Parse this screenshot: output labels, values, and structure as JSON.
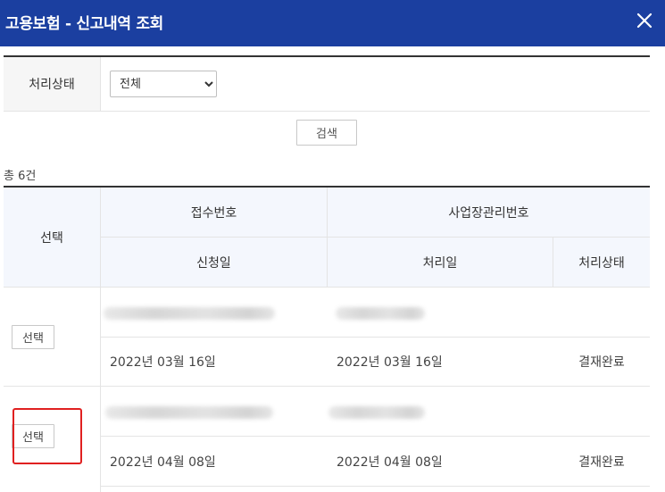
{
  "header": {
    "title": "고용보험 - 신고내역 조회",
    "close_icon": "close-icon"
  },
  "filter": {
    "label": "처리상태",
    "selected": "전체"
  },
  "search_label": "검색",
  "total_label": "총 6건",
  "table": {
    "headers": {
      "select": "선택",
      "receipt_no": "접수번호",
      "workplace_no": "사업장관리번호",
      "apply_date": "신청일",
      "process_date": "처리일",
      "status": "처리상태"
    },
    "rows": [
      {
        "select_label": "선택",
        "apply_date": "2022년 03월 16일",
        "process_date": "2022년 03월 16일",
        "status": "결재완료"
      },
      {
        "select_label": "선택",
        "apply_date": "2022년 04월 08일",
        "process_date": "2022년 04월 08일",
        "status": "결재완료"
      }
    ]
  },
  "colors": {
    "header_bg": "#1b3fa0",
    "header_cell_bg": "#f4f7fd",
    "highlight": "#e02020"
  }
}
